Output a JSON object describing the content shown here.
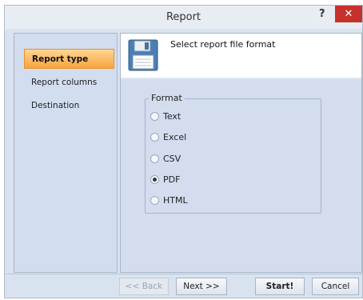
{
  "window": {
    "title": "Report",
    "help_label": "?",
    "close_label": "✕"
  },
  "sidebar": {
    "items": [
      {
        "label": "Report type",
        "active": true
      },
      {
        "label": "Report columns",
        "active": false
      },
      {
        "label": "Destination",
        "active": false
      }
    ]
  },
  "main": {
    "header_text": "Select report file format",
    "format": {
      "legend": "Format",
      "options": [
        {
          "label": "Text",
          "checked": false
        },
        {
          "label": "Excel",
          "checked": false
        },
        {
          "label": "CSV",
          "checked": false
        },
        {
          "label": "PDF",
          "checked": true
        },
        {
          "label": "HTML",
          "checked": false
        }
      ]
    }
  },
  "footer": {
    "back_label": "<< Back",
    "next_label": "Next >>",
    "start_label": "Start!",
    "cancel_label": "Cancel"
  },
  "icons": {
    "header_icon": "floppy-disk-icon"
  },
  "colors": {
    "active_nav": "#f7a440",
    "close_button": "#c7312b"
  }
}
